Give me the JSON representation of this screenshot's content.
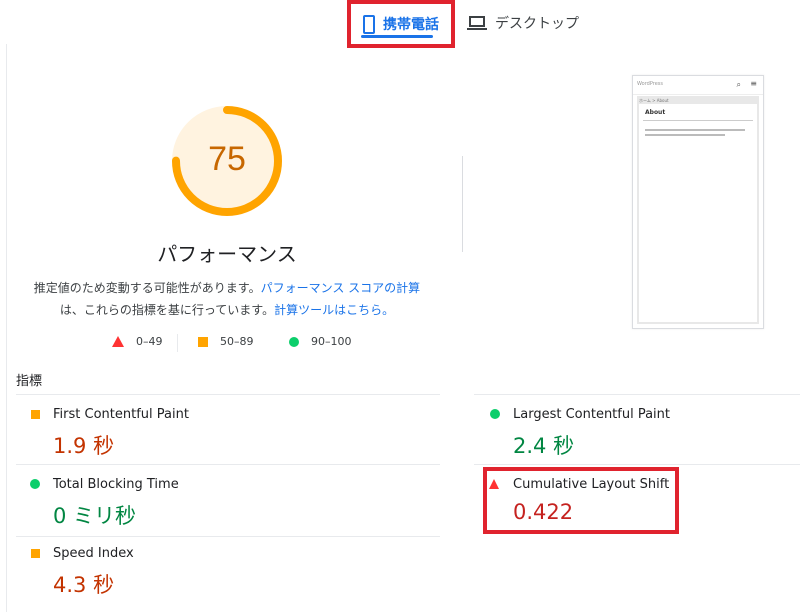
{
  "tabs": {
    "mobile": {
      "label": "携帯電話",
      "icon": "phone-icon",
      "active": true
    },
    "desktop": {
      "label": "デスクトップ",
      "icon": "laptop-icon"
    }
  },
  "gauge": {
    "score": "75",
    "color": "#ffa400"
  },
  "performance": {
    "title": "パフォーマンス",
    "desc_part1": "推定値のため変動する可能性があります。",
    "desc_link1": "パフォーマンス スコアの計算",
    "desc_part2": "は、これらの指標を基に行っています。",
    "desc_link2": "計算ツールはこちら。"
  },
  "legend": {
    "fail": "0–49",
    "average": "50–89",
    "pass": "90–100"
  },
  "thumbnail": {
    "site_logo": "WordPress",
    "breadcrumb": "ホーム > About",
    "heading": "About"
  },
  "metrics": {
    "heading": "指標",
    "items": [
      {
        "label": "First Contentful Paint",
        "value": "1.9 秒",
        "status": "average"
      },
      {
        "label": "Largest Contentful Paint",
        "value": "2.4 秒",
        "status": "pass"
      },
      {
        "label": "Total Blocking Time",
        "value": "0 ミリ秒",
        "status": "pass"
      },
      {
        "label": "Cumulative Layout Shift",
        "value": "0.422",
        "status": "fail"
      },
      {
        "label": "Speed Index",
        "value": "4.3 秒",
        "status": "average"
      }
    ]
  },
  "colors": {
    "accent": "#1a73e8",
    "fail": "#ff3333",
    "average": "#ffa400",
    "pass": "#0cce6b",
    "highlight": "#e0232e"
  }
}
